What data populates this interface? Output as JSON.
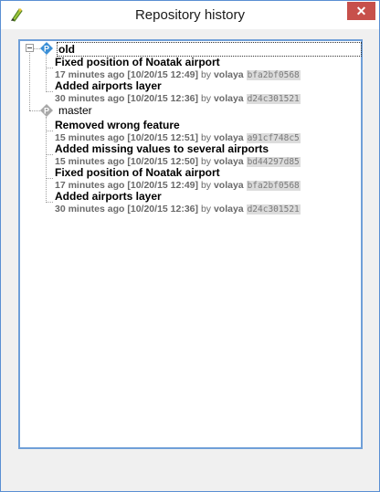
{
  "window": {
    "title": "Repository history",
    "close_label": "✕"
  },
  "branches": [
    {
      "name": "old",
      "selected": true,
      "commits": [
        {
          "message": "Fixed position of Noatak airport",
          "ago": "17 minutes ago",
          "date": "[10/20/15 12:49]",
          "by": "by",
          "author": "volaya",
          "hash": "bfa2bf0568"
        },
        {
          "message": "Added airports layer",
          "ago": "30 minutes ago",
          "date": "[10/20/15 12:36]",
          "by": "by",
          "author": "volaya",
          "hash": "d24c301521"
        }
      ]
    },
    {
      "name": "master",
      "selected": false,
      "commits": [
        {
          "message": "Removed wrong feature",
          "ago": "15 minutes ago",
          "date": "[10/20/15 12:51]",
          "by": "by",
          "author": "volaya",
          "hash": "a91cf748c5"
        },
        {
          "message": "Added missing values to several airports",
          "ago": "15 minutes ago",
          "date": "[10/20/15 12:50]",
          "by": "by",
          "author": "volaya",
          "hash": "bd44297d85"
        },
        {
          "message": "Fixed position of Noatak airport",
          "ago": "17 minutes ago",
          "date": "[10/20/15 12:49]",
          "by": "by",
          "author": "volaya",
          "hash": "bfa2bf0568"
        },
        {
          "message": "Added airports layer",
          "ago": "30 minutes ago",
          "date": "[10/20/15 12:36]",
          "by": "by",
          "author": "volaya",
          "hash": "d24c301521"
        }
      ]
    }
  ]
}
